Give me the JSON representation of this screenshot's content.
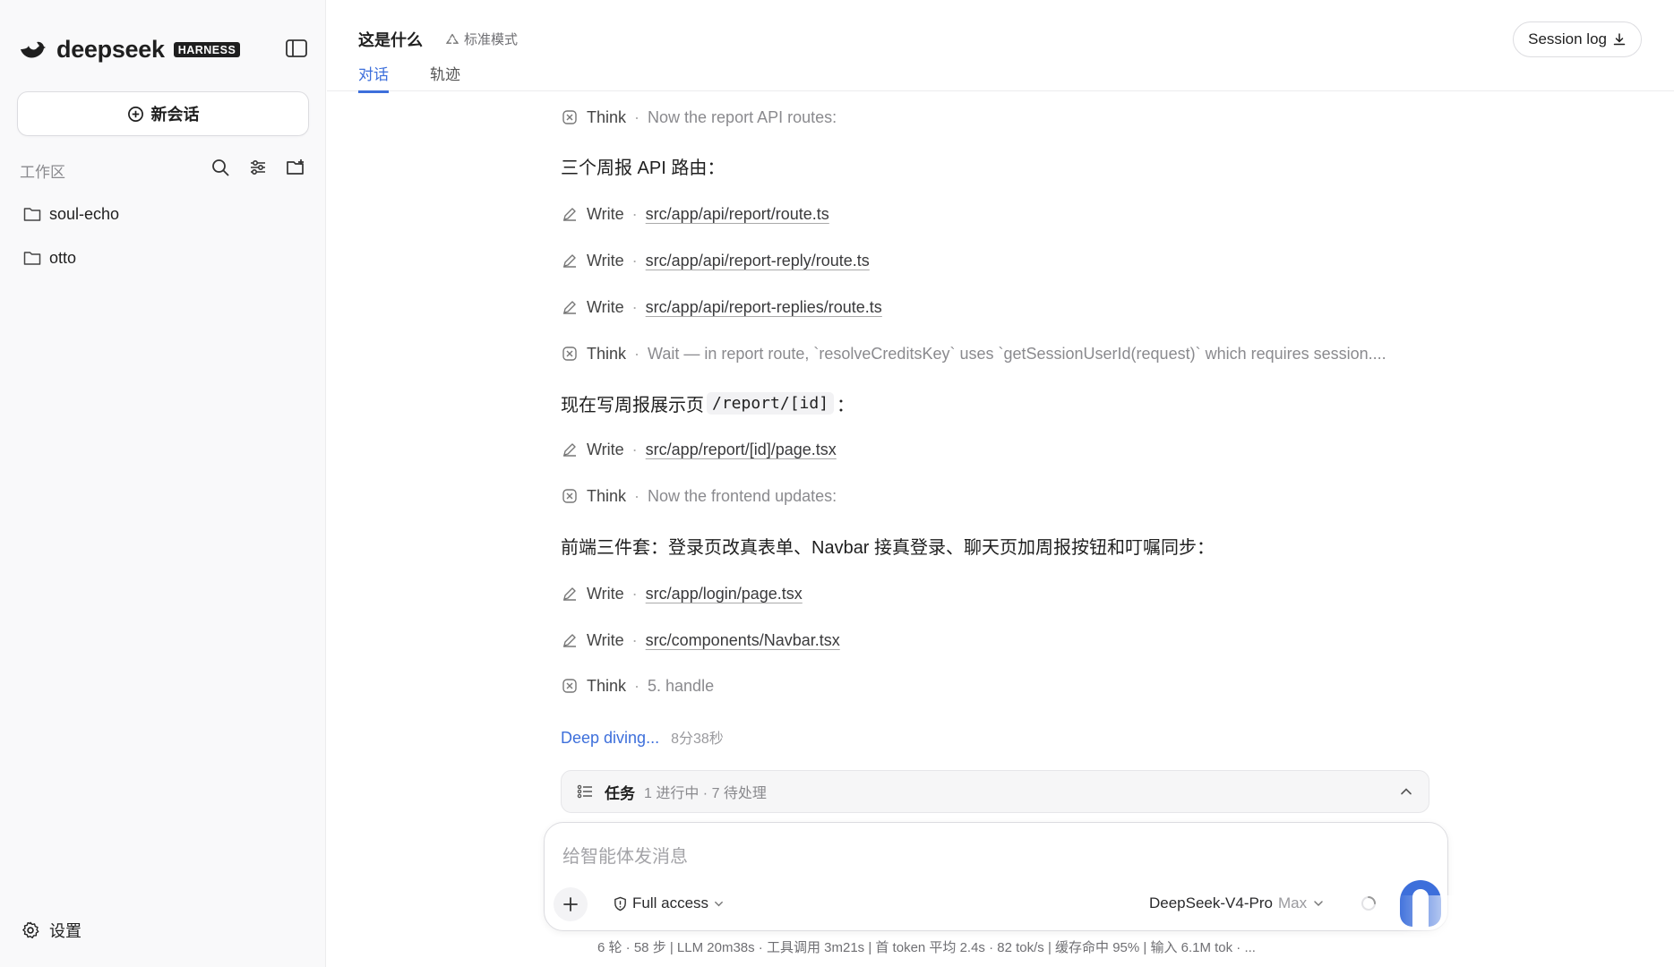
{
  "app": {
    "brand_name": "deepseek",
    "brand_badge": "HARNESS",
    "accent_color": "#3d6fdb"
  },
  "sidebar": {
    "new_chat_label": "新会话",
    "workspace_label": "工作区",
    "folders": [
      {
        "label": "soul-echo",
        "icon": "folder-icon"
      },
      {
        "label": "otto",
        "icon": "folder-icon"
      }
    ],
    "settings_label": "设置"
  },
  "header": {
    "title": "这是什么",
    "mode": "标准模式",
    "tabs": [
      {
        "label": "对话",
        "active": true
      },
      {
        "label": "轨迹",
        "active": false
      }
    ],
    "session_log_label": "Session log"
  },
  "conversation": {
    "entries": [
      {
        "type": "think",
        "label": "Think",
        "text": "Now the report API routes:"
      },
      {
        "type": "heading",
        "text": "三个周报 API 路由："
      },
      {
        "type": "write",
        "label": "Write",
        "path": "src/app/api/report/route.ts"
      },
      {
        "type": "write",
        "label": "Write",
        "path": "src/app/api/report-reply/route.ts"
      },
      {
        "type": "write",
        "label": "Write",
        "path": "src/app/api/report-replies/route.ts"
      },
      {
        "type": "think",
        "label": "Think",
        "text": "Wait — in report route, `resolveCreditsKey` uses `getSessionUserId(request)` which requires session...."
      },
      {
        "type": "heading",
        "text_before": "现在写周报展示页",
        "code": "/report/[id]",
        "text_after": "："
      },
      {
        "type": "write",
        "label": "Write",
        "path": "src/app/report/[id]/page.tsx"
      },
      {
        "type": "think",
        "label": "Think",
        "text": "Now the frontend updates:"
      },
      {
        "type": "heading",
        "text": "前端三件套：登录页改真表单、Navbar 接真登录、聊天页加周报按钮和叮嘱同步："
      },
      {
        "type": "write",
        "label": "Write",
        "path": "src/app/login/page.tsx"
      },
      {
        "type": "write",
        "label": "Write",
        "path": "src/components/Navbar.tsx"
      },
      {
        "type": "think",
        "label": "Think",
        "text": "5. handle"
      }
    ],
    "status_text": "Deep diving...",
    "elapsed": "8分38秒"
  },
  "tasks": {
    "label": "任务",
    "status": "1 进行中 · 7 待处理"
  },
  "composer": {
    "placeholder": "给智能体发消息",
    "access_label": "Full access",
    "model_name": "DeepSeek-V4-Pro",
    "model_tier": "Max"
  },
  "statusbar": {
    "text": "6 轮 · 58 步  |  LLM 20m38s · 工具调用 3m21s  |  首 token 平均 2.4s · 82 tok/s  |  缓存命中 95%  |  输入 6.1M tok · ..."
  }
}
